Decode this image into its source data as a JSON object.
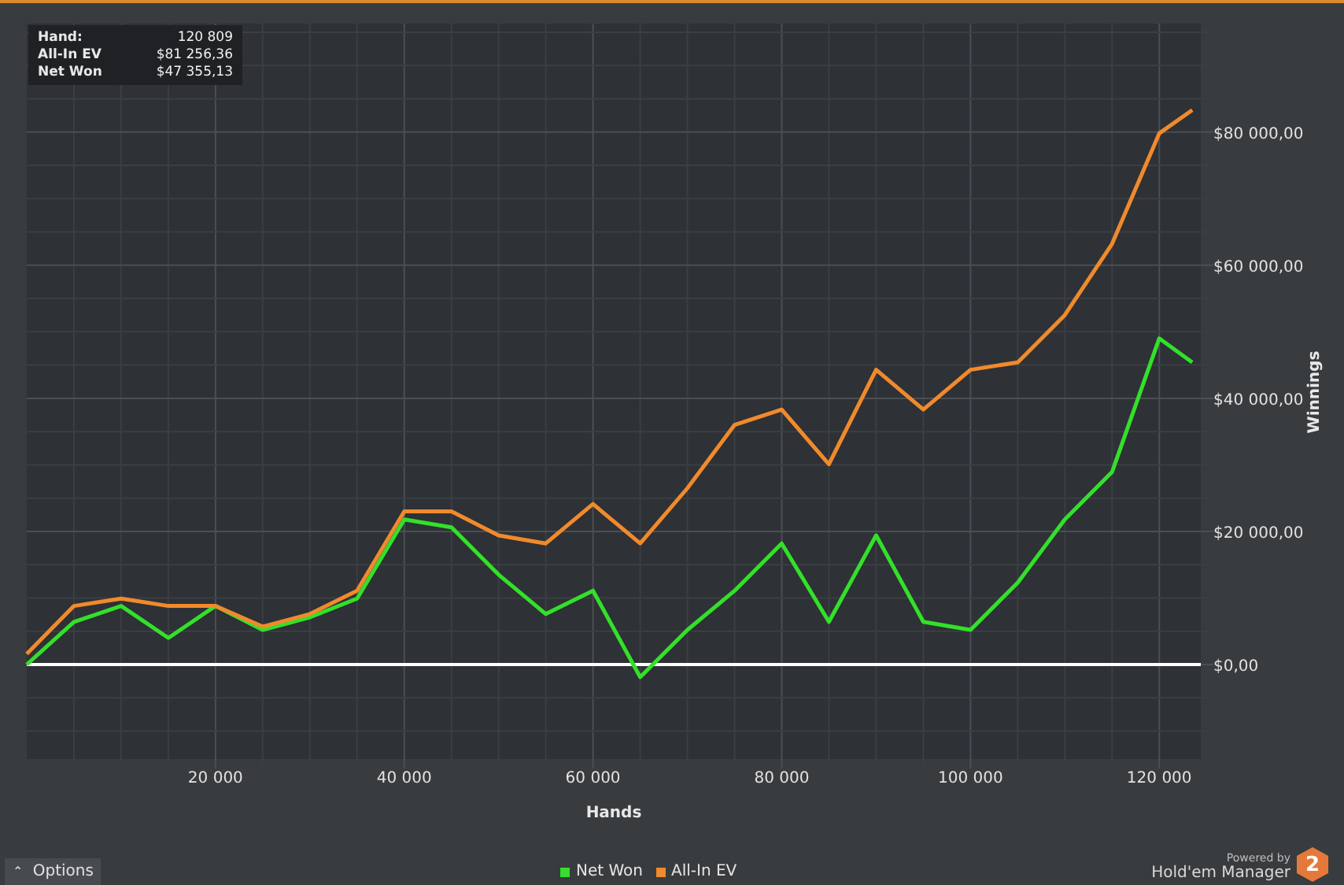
{
  "chart": {
    "tooltip": [
      {
        "label": "Hand:",
        "value": "120 809"
      },
      {
        "label": "All-In EV",
        "value": "$81 256,36"
      },
      {
        "label": "Net Won",
        "value": "$47 355,13"
      }
    ],
    "chart_data": {
      "type": "line",
      "grid": true,
      "xlabel": "Hands",
      "ylabel": "Winnings",
      "xlim": [
        0,
        124400
      ],
      "ylim": [
        -14200,
        96300
      ],
      "x": [
        0,
        5000,
        10000,
        15000,
        20000,
        25000,
        30000,
        35000,
        40000,
        45000,
        50000,
        55000,
        60000,
        65000,
        70000,
        75000,
        80000,
        85000,
        90000,
        95000,
        100000,
        105000,
        110000,
        115000,
        120000,
        123500
      ],
      "series": [
        {
          "name": "Net Won",
          "color": "#33e02a",
          "values": [
            0,
            6400,
            8800,
            4000,
            8800,
            5200,
            7100,
            9900,
            21800,
            20600,
            13500,
            7600,
            11100,
            -1900,
            5200,
            11100,
            18200,
            6400,
            19400,
            6400,
            5200,
            12300,
            21800,
            28900,
            49000,
            45400
          ]
        },
        {
          "name": "All-In EV",
          "color": "#f08a2c",
          "values": [
            1600,
            8800,
            9900,
            8800,
            8800,
            5700,
            7600,
            11100,
            23000,
            23000,
            19400,
            18200,
            24100,
            18200,
            26500,
            36000,
            38300,
            30100,
            44300,
            38300,
            44300,
            45400,
            52500,
            63200,
            79800,
            83300
          ]
        }
      ],
      "xticks": [
        {
          "value": 20000,
          "label": "20 000"
        },
        {
          "value": 40000,
          "label": "40 000"
        },
        {
          "value": 60000,
          "label": "60 000"
        },
        {
          "value": 80000,
          "label": "80 000"
        },
        {
          "value": 100000,
          "label": "100 000"
        },
        {
          "value": 120000,
          "label": "120 000"
        }
      ],
      "yticks": [
        {
          "value": 0,
          "label": "$0,00"
        },
        {
          "value": 20000,
          "label": "$20 000,00"
        },
        {
          "value": 40000,
          "label": "$40 000,00"
        },
        {
          "value": 60000,
          "label": "$60 000,00"
        },
        {
          "value": 80000,
          "label": "$80 000,00"
        }
      ]
    }
  },
  "footer": {
    "options_button": {
      "icon": "⌃",
      "label": "Options"
    },
    "powered_by": "Powered by",
    "product": "Hold'em Manager",
    "logo": "2"
  }
}
